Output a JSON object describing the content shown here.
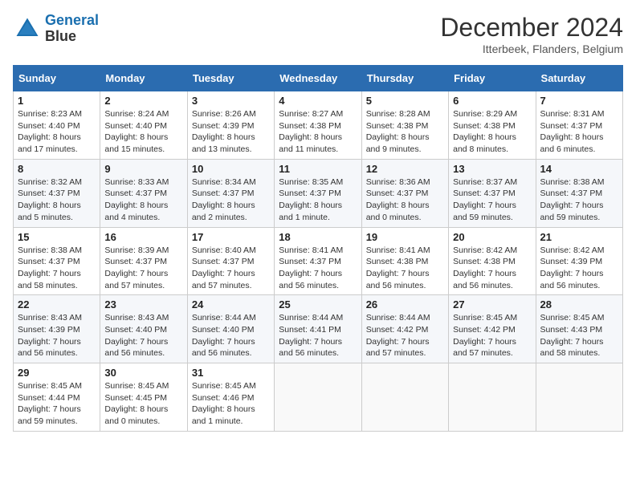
{
  "header": {
    "logo_line1": "General",
    "logo_line2": "Blue",
    "month": "December 2024",
    "location": "Itterbeek, Flanders, Belgium"
  },
  "weekdays": [
    "Sunday",
    "Monday",
    "Tuesday",
    "Wednesday",
    "Thursday",
    "Friday",
    "Saturday"
  ],
  "weeks": [
    [
      {
        "day": "1",
        "sunrise": "8:23 AM",
        "sunset": "4:40 PM",
        "daylight": "8 hours and 17 minutes."
      },
      {
        "day": "2",
        "sunrise": "8:24 AM",
        "sunset": "4:40 PM",
        "daylight": "8 hours and 15 minutes."
      },
      {
        "day": "3",
        "sunrise": "8:26 AM",
        "sunset": "4:39 PM",
        "daylight": "8 hours and 13 minutes."
      },
      {
        "day": "4",
        "sunrise": "8:27 AM",
        "sunset": "4:38 PM",
        "daylight": "8 hours and 11 minutes."
      },
      {
        "day": "5",
        "sunrise": "8:28 AM",
        "sunset": "4:38 PM",
        "daylight": "8 hours and 9 minutes."
      },
      {
        "day": "6",
        "sunrise": "8:29 AM",
        "sunset": "4:38 PM",
        "daylight": "8 hours and 8 minutes."
      },
      {
        "day": "7",
        "sunrise": "8:31 AM",
        "sunset": "4:37 PM",
        "daylight": "8 hours and 6 minutes."
      }
    ],
    [
      {
        "day": "8",
        "sunrise": "8:32 AM",
        "sunset": "4:37 PM",
        "daylight": "8 hours and 5 minutes."
      },
      {
        "day": "9",
        "sunrise": "8:33 AM",
        "sunset": "4:37 PM",
        "daylight": "8 hours and 4 minutes."
      },
      {
        "day": "10",
        "sunrise": "8:34 AM",
        "sunset": "4:37 PM",
        "daylight": "8 hours and 2 minutes."
      },
      {
        "day": "11",
        "sunrise": "8:35 AM",
        "sunset": "4:37 PM",
        "daylight": "8 hours and 1 minute."
      },
      {
        "day": "12",
        "sunrise": "8:36 AM",
        "sunset": "4:37 PM",
        "daylight": "8 hours and 0 minutes."
      },
      {
        "day": "13",
        "sunrise": "8:37 AM",
        "sunset": "4:37 PM",
        "daylight": "7 hours and 59 minutes."
      },
      {
        "day": "14",
        "sunrise": "8:38 AM",
        "sunset": "4:37 PM",
        "daylight": "7 hours and 59 minutes."
      }
    ],
    [
      {
        "day": "15",
        "sunrise": "8:38 AM",
        "sunset": "4:37 PM",
        "daylight": "7 hours and 58 minutes."
      },
      {
        "day": "16",
        "sunrise": "8:39 AM",
        "sunset": "4:37 PM",
        "daylight": "7 hours and 57 minutes."
      },
      {
        "day": "17",
        "sunrise": "8:40 AM",
        "sunset": "4:37 PM",
        "daylight": "7 hours and 57 minutes."
      },
      {
        "day": "18",
        "sunrise": "8:41 AM",
        "sunset": "4:37 PM",
        "daylight": "7 hours and 56 minutes."
      },
      {
        "day": "19",
        "sunrise": "8:41 AM",
        "sunset": "4:38 PM",
        "daylight": "7 hours and 56 minutes."
      },
      {
        "day": "20",
        "sunrise": "8:42 AM",
        "sunset": "4:38 PM",
        "daylight": "7 hours and 56 minutes."
      },
      {
        "day": "21",
        "sunrise": "8:42 AM",
        "sunset": "4:39 PM",
        "daylight": "7 hours and 56 minutes."
      }
    ],
    [
      {
        "day": "22",
        "sunrise": "8:43 AM",
        "sunset": "4:39 PM",
        "daylight": "7 hours and 56 minutes."
      },
      {
        "day": "23",
        "sunrise": "8:43 AM",
        "sunset": "4:40 PM",
        "daylight": "7 hours and 56 minutes."
      },
      {
        "day": "24",
        "sunrise": "8:44 AM",
        "sunset": "4:40 PM",
        "daylight": "7 hours and 56 minutes."
      },
      {
        "day": "25",
        "sunrise": "8:44 AM",
        "sunset": "4:41 PM",
        "daylight": "7 hours and 56 minutes."
      },
      {
        "day": "26",
        "sunrise": "8:44 AM",
        "sunset": "4:42 PM",
        "daylight": "7 hours and 57 minutes."
      },
      {
        "day": "27",
        "sunrise": "8:45 AM",
        "sunset": "4:42 PM",
        "daylight": "7 hours and 57 minutes."
      },
      {
        "day": "28",
        "sunrise": "8:45 AM",
        "sunset": "4:43 PM",
        "daylight": "7 hours and 58 minutes."
      }
    ],
    [
      {
        "day": "29",
        "sunrise": "8:45 AM",
        "sunset": "4:44 PM",
        "daylight": "7 hours and 59 minutes."
      },
      {
        "day": "30",
        "sunrise": "8:45 AM",
        "sunset": "4:45 PM",
        "daylight": "8 hours and 0 minutes."
      },
      {
        "day": "31",
        "sunrise": "8:45 AM",
        "sunset": "4:46 PM",
        "daylight": "8 hours and 1 minute."
      },
      null,
      null,
      null,
      null
    ]
  ]
}
